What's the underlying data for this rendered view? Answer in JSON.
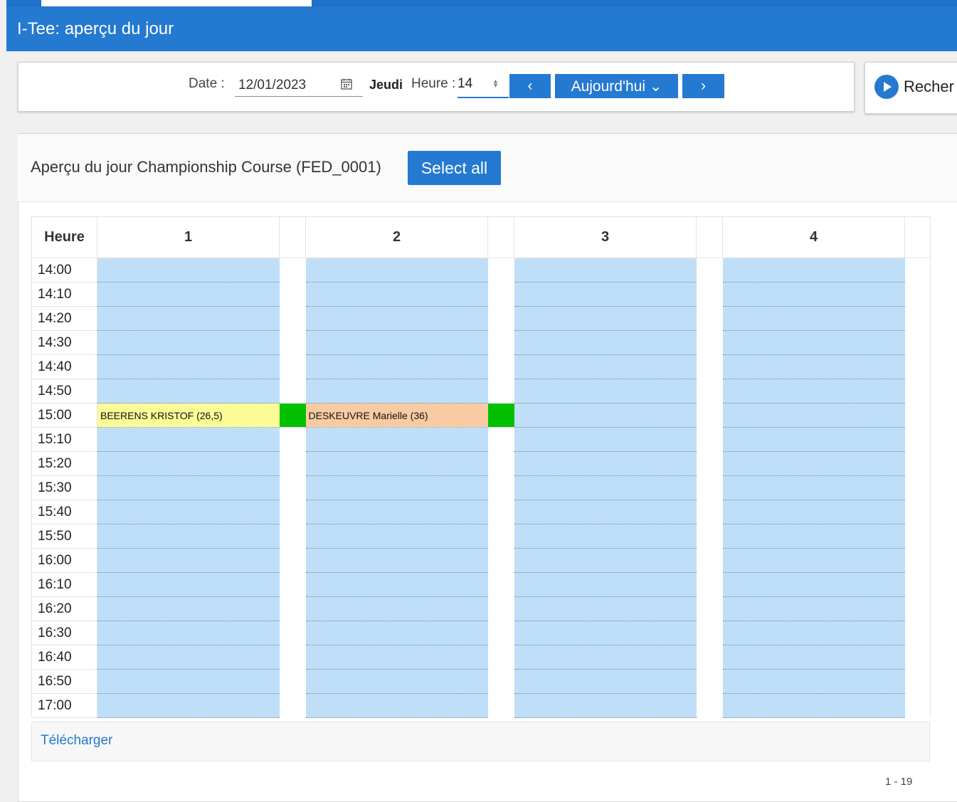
{
  "header": {
    "title": "I-Tee: aperçu du jour"
  },
  "toolbar": {
    "date_label": "Date :",
    "date_value": "12/01/2023",
    "day_name": "Jeudi",
    "hour_label": "Heure :",
    "hour_value": "14",
    "prev_label": "‹",
    "today_label": "Aujourd'hui ⌄",
    "next_label": "›",
    "search_label": "Recher"
  },
  "card": {
    "title": "Aperçu du jour Championship Course (FED_0001)",
    "select_all_label": "Select all"
  },
  "grid": {
    "time_header": "Heure",
    "columns": [
      "1",
      "2",
      "3",
      "4"
    ],
    "times": [
      "14:00",
      "14:10",
      "14:20",
      "14:30",
      "14:40",
      "14:50",
      "15:00",
      "15:10",
      "15:20",
      "15:30",
      "15:40",
      "15:50",
      "16:00",
      "16:10",
      "16:20",
      "16:30",
      "16:40",
      "16:50",
      "17:00"
    ],
    "bookings": [
      {
        "time": "15:00",
        "column": 1,
        "text": "BEERENS KRISTOF (26,5)",
        "color": "#fbfb98"
      },
      {
        "time": "15:00",
        "column": 2,
        "text": "DESKEUVRE Marielle (36)",
        "color": "#f9cba3"
      }
    ],
    "colors": {
      "slot": "#bfdff9",
      "marker": "#00c000",
      "accent": "#2479d0"
    }
  },
  "footer": {
    "download_label": "Télécharger",
    "pager": "1 - 19"
  }
}
